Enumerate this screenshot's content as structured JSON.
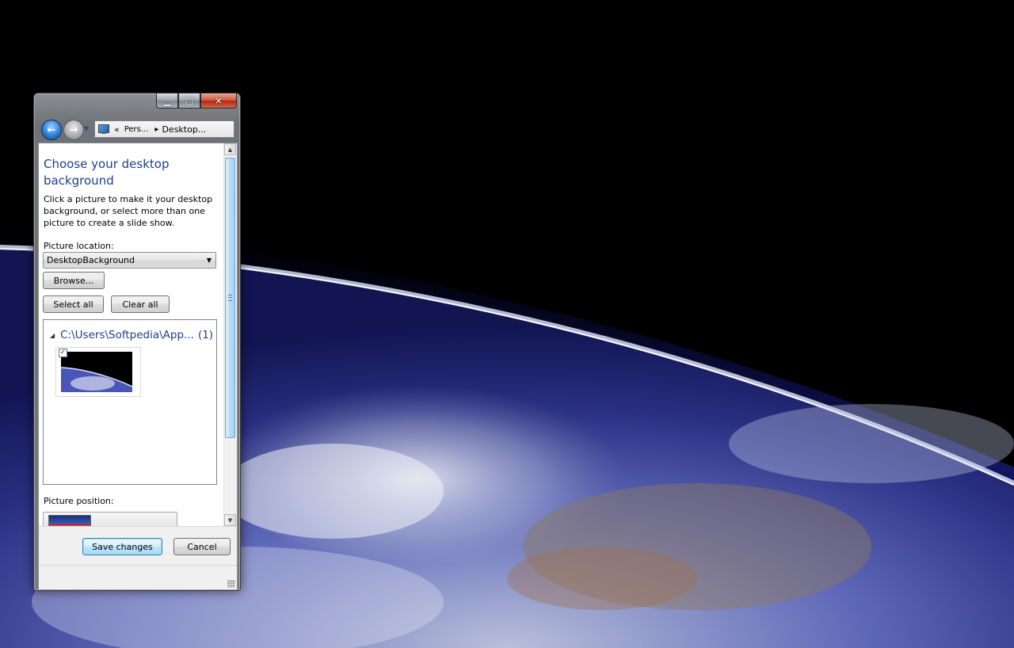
{
  "window": {
    "caption_buttons": {
      "minimize": "minimize-icon",
      "maximize": "maximize-icon",
      "close": "close-icon"
    }
  },
  "navbar": {
    "back_icon": "back-arrow-icon",
    "forward_icon": "forward-arrow-icon",
    "breadcrumb": {
      "prefix": "«",
      "items": [
        "Pers...",
        "Desktop..."
      ],
      "separator": "▸"
    }
  },
  "content": {
    "title": "Choose your desktop background",
    "description": "Click a picture to make it your desktop background, or select more than one picture to create a slide show.",
    "picture_location_label": "Picture location:",
    "picture_location_value": "DesktopBackground",
    "browse_label": "Browse...",
    "select_all_label": "Select all",
    "clear_all_label": "Clear all",
    "group": {
      "path": "C:\\Users\\Softpedia\\App...",
      "count": "(1)"
    },
    "picture": {
      "checked": true,
      "check_glyph": "✓"
    },
    "picture_position_label": "Picture position:"
  },
  "footer": {
    "save_label": "Save changes",
    "cancel_label": "Cancel"
  },
  "colors": {
    "heading": "#1e3f8c",
    "space": "#000000",
    "atmosphere": "#4a5fd8"
  }
}
